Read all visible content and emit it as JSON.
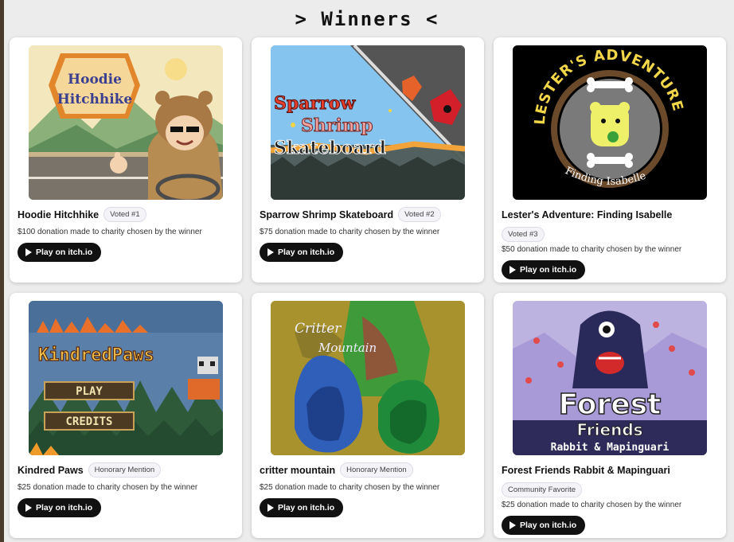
{
  "page": {
    "heading": "> Winners <"
  },
  "cards": [
    {
      "title": "Hoodie Hitchhike",
      "badge": "Voted #1",
      "desc": "$100 donation made to charity chosen by the winner",
      "button": "Play on itch.io",
      "art": {
        "line1": "Hoodie",
        "line2": "Hitchhike"
      }
    },
    {
      "title": "Sparrow Shrimp Skateboard",
      "badge": "Voted #2",
      "desc": "$75 donation made to charity chosen by the winner",
      "button": "Play on itch.io",
      "art": {
        "line1": "Sparrow",
        "line2": "Shrimp",
        "line3": "Skateboard"
      }
    },
    {
      "title": "Lester's Adventure: Finding Isabelle",
      "badge": "Voted #3",
      "desc": "$50 donation made to charity chosen by the winner",
      "button": "Play on itch.io",
      "art": {
        "line1": "LESTER'S ADVENTURE",
        "line2": "Finding Isabelle"
      }
    },
    {
      "title": "Kindred Paws",
      "badge": "Honorary Mention",
      "desc": "$25 donation made to charity chosen by the winner",
      "button": "Play on itch.io",
      "art": {
        "line1": "KindredPaws",
        "line2": "PLAY",
        "line3": "CREDITS"
      }
    },
    {
      "title": "critter mountain",
      "badge": "Honorary Mention",
      "desc": "$25 donation made to charity chosen by the winner",
      "button": "Play on itch.io",
      "art": {
        "line1": "Critter",
        "line2": "Mountain"
      }
    },
    {
      "title": "Forest Friends Rabbit & Mapinguari",
      "badge": "Community Favorite",
      "desc": "$25 donation made to charity chosen by the winner",
      "button": "Play on itch.io",
      "art": {
        "line1": "Forest",
        "line2": "Friends",
        "line3": "Rabbit & Mapinguari"
      }
    }
  ],
  "colors": {
    "button_bg": "#111111",
    "badge_bg": "#f4f4f8",
    "card_bg": "#ffffff"
  }
}
